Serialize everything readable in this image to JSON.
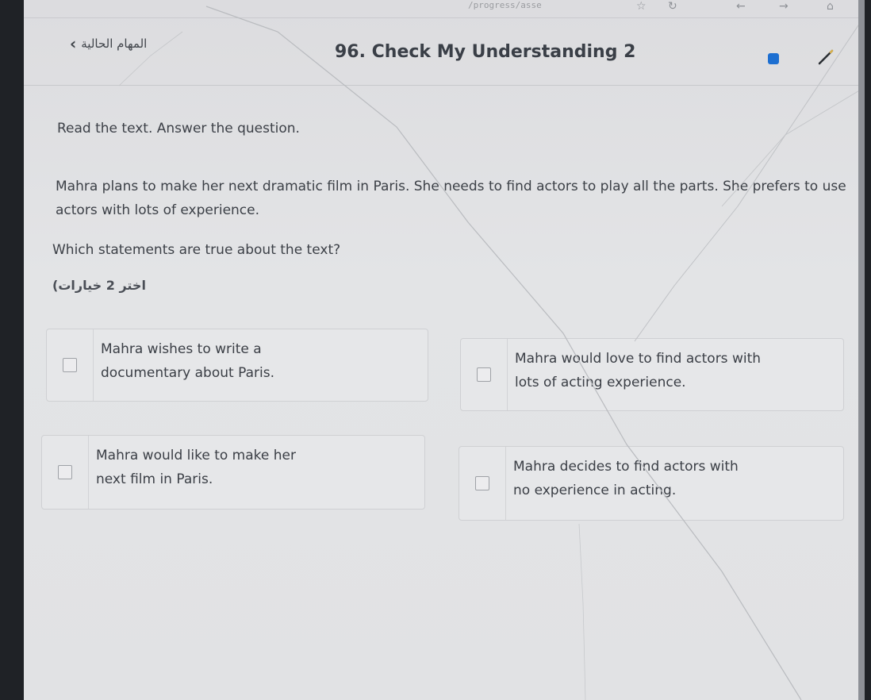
{
  "browser": {
    "url_fragment": "/progress/asse"
  },
  "header": {
    "back_label": "المهام الحالية",
    "title": "96. Check My Understanding 2"
  },
  "content": {
    "instruction": "Read the text. Answer the question.",
    "passage": "Mahra plans to make her next dramatic film in Paris. She needs to find actors to play all the parts. She prefers to use actors with lots of experience.",
    "question": "Which statements are true about the text?",
    "select_hint": "اختر 2 خيارات)"
  },
  "options": [
    {
      "text": "Mahra wishes to write a documentary about Paris.",
      "checked": false
    },
    {
      "text": "Mahra would love to find actors with lots of acting experience.",
      "checked": false
    },
    {
      "text": "Mahra would like to make her next film in Paris.",
      "checked": false
    },
    {
      "text": "Mahra decides to find actors with no experience in acting.",
      "checked": false
    }
  ],
  "colors": {
    "accent_blue": "#1d6fd1",
    "background": "#e1e2e4",
    "text": "#3c4047"
  }
}
